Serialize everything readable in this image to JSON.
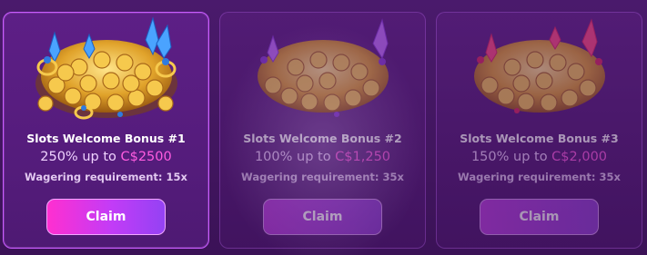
{
  "cards": [
    {
      "title": "Slots Welcome Bonus #1",
      "percent_text": "250% up to ",
      "amount_text": "C$2500",
      "wagering": "Wagering requirement: 15x",
      "claim_label": "Claim",
      "state": "active",
      "gem_colors": [
        "#4aa3ff",
        "#2f7be0"
      ]
    },
    {
      "title": "Slots Welcome Bonus #2",
      "percent_text": "100% up to ",
      "amount_text": "C$1,250",
      "wagering": "Wagering requirement: 35x",
      "claim_label": "Claim",
      "state": "dim",
      "gem_colors": [
        "#c472ff",
        "#8a3bd8"
      ]
    },
    {
      "title": "Slots Welcome Bonus #3",
      "percent_text": "150% up to ",
      "amount_text": "C$2,000",
      "wagering": "Wagering requirement: 35x",
      "claim_label": "Claim",
      "state": "dim",
      "gem_colors": [
        "#ff4a7a",
        "#d8265a"
      ]
    }
  ],
  "colors": {
    "accent_pink": "#ff5ce0",
    "card_border": "#c85bff",
    "background": "#421660",
    "gold": "#e8b23a"
  }
}
